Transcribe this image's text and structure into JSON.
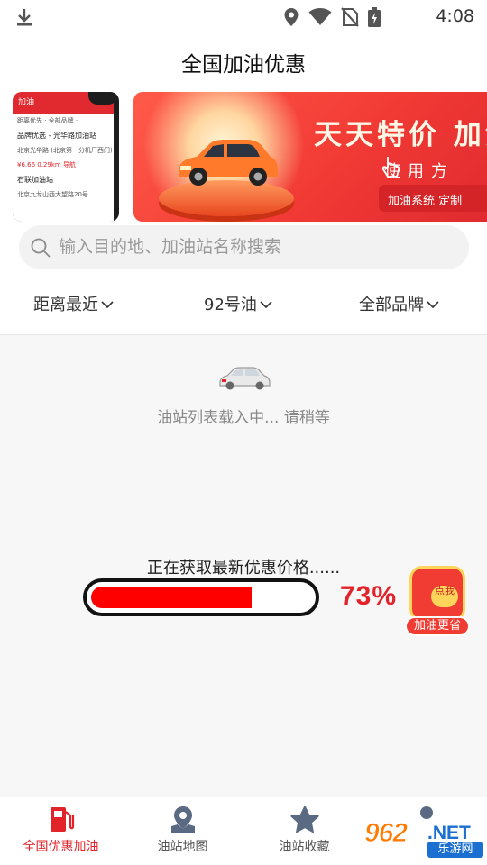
{
  "status_bar": {
    "time": "4:08",
    "icons": [
      "download-icon",
      "location-icon",
      "wifi-icon",
      "no-sim-icon",
      "battery-charging-icon"
    ]
  },
  "header": {
    "title": "全国加油优惠"
  },
  "banner_left": {
    "top_label": "加油",
    "row1": "距离优先 ·        全部品牌 ·",
    "row2": "品牌优选 - 光华路加油站",
    "row3": "北京光华路   (北京第一分机厂西门)",
    "row4": "¥6.66               0.29km    导航",
    "row5": "石联加油站",
    "row6": "北京九龙山西大望路20号"
  },
  "banner_right": {
    "headline": "天天特价 加油",
    "subline": "使用方",
    "footer": "加油系统 定制"
  },
  "search": {
    "placeholder": "输入目的地、加油站名称搜索"
  },
  "filters": {
    "sort": "距离最近",
    "fuel": "92号油",
    "brand": "全部品牌"
  },
  "content": {
    "loading_text": "油站列表载入中... 请稍等",
    "fetch_text": "正在获取最新优惠价格......",
    "progress_percent": 73,
    "progress_label": "73%"
  },
  "redpacket": {
    "seal": "点我",
    "label": "加油更省"
  },
  "tabs": [
    {
      "label": "全国优惠加油",
      "icon": "gas-pump-icon",
      "active": true
    },
    {
      "label": "油站地图",
      "icon": "map-pin-icon",
      "active": false
    },
    {
      "label": "油站收藏",
      "icon": "star-icon",
      "active": false
    },
    {
      "label": "",
      "icon": "profile-icon",
      "active": false
    }
  ],
  "watermark": {
    "number": "962",
    "net": ".NET",
    "cn": "乐游网"
  },
  "colors": {
    "accent": "#e3232a",
    "progress": "#ff0000",
    "banner": "#f23b35"
  }
}
